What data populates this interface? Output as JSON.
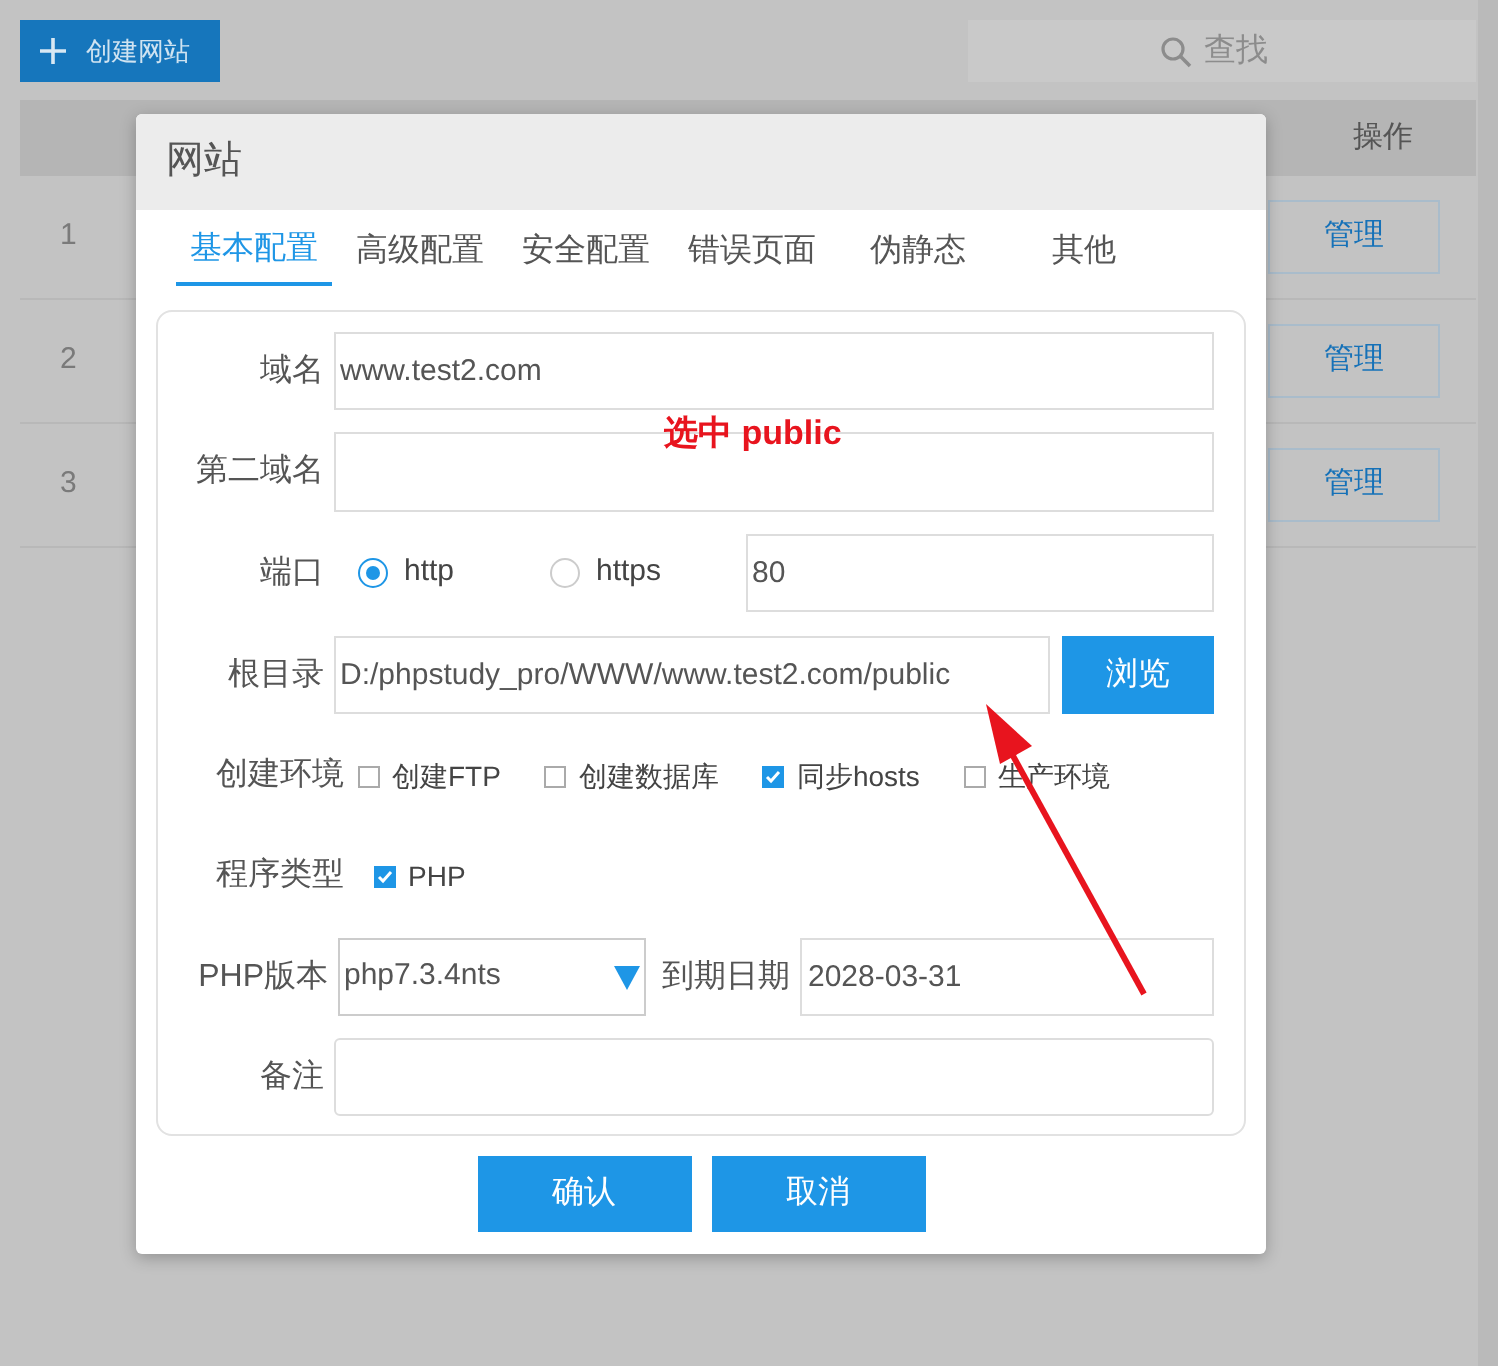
{
  "toolbar": {
    "create_button": "创建网站",
    "search": {
      "placeholder": "查找"
    }
  },
  "table": {
    "columns": [
      {
        "label": "操作"
      }
    ],
    "rows": [
      {
        "index": "1",
        "action": "管理"
      },
      {
        "index": "2",
        "action": "管理"
      },
      {
        "index": "3",
        "action": "管理"
      }
    ]
  },
  "dialog": {
    "title": "网站",
    "tabs": [
      {
        "label": "基本配置",
        "selected": true
      },
      {
        "label": "高级配置",
        "selected": false
      },
      {
        "label": "安全配置",
        "selected": false
      },
      {
        "label": "错误页面",
        "selected": false
      },
      {
        "label": "伪静态",
        "selected": false
      },
      {
        "label": "其他",
        "selected": false
      }
    ],
    "domain": {
      "label": "域名",
      "value": "www.test2.com"
    },
    "second_domain": {
      "label": "第二域名"
    },
    "port": {
      "label": "端口",
      "options": [
        {
          "label": "http",
          "selected": true
        },
        {
          "label": "https",
          "selected": false
        }
      ],
      "value": "80"
    },
    "root": {
      "label": "根目录",
      "value": "D:/phpstudy_pro/WWW/www.test2.com/public",
      "button": "浏览"
    },
    "environment": {
      "label": "创建环境",
      "options": [
        {
          "label": "创建FTP",
          "checked": false
        },
        {
          "label": "创建数据库",
          "checked": false
        },
        {
          "label": "同步hosts",
          "checked": true
        },
        {
          "label": "生产环境",
          "checked": false
        }
      ]
    },
    "program_type": {
      "label": "程序类型",
      "options": [
        {
          "label": "PHP",
          "checked": true
        }
      ]
    },
    "php_version": {
      "label": "PHP版本",
      "value": "php7.3.4nts"
    },
    "expiry": {
      "label": "到期日期",
      "value": "2028-03-31"
    },
    "note": {
      "label": "备注"
    },
    "buttons": [
      "确认",
      "取消"
    ]
  },
  "annotation": {
    "text": "选中 public"
  }
}
